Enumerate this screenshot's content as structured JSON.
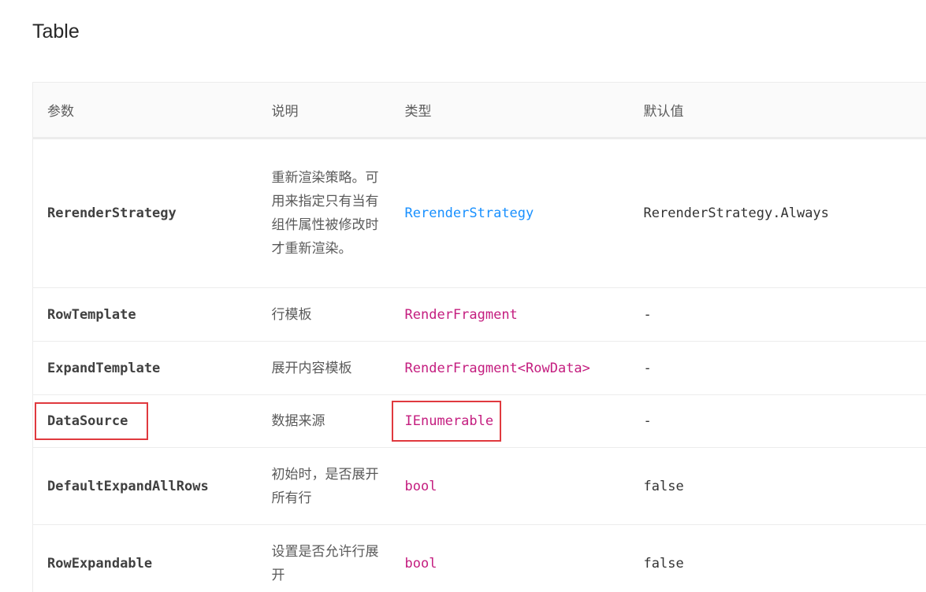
{
  "page": {
    "title": "Table"
  },
  "table": {
    "headers": [
      "参数",
      "说明",
      "类型",
      "默认值"
    ],
    "rows": [
      {
        "param": "RerenderStrategy",
        "description": "重新渲染策略。可用来指定只有当有组件属性被修改时才重新渲染。",
        "type": "RerenderStrategy",
        "type_style": "link",
        "default": "RerenderStrategy.Always"
      },
      {
        "param": "RowTemplate",
        "description": "行模板",
        "type": "RenderFragment",
        "type_style": "code",
        "default": "-"
      },
      {
        "param": "ExpandTemplate",
        "description": "展开内容模板",
        "type": "RenderFragment<RowData>",
        "type_style": "code",
        "default": "-"
      },
      {
        "param": "DataSource",
        "description": "数据来源",
        "type": "IEnumerable",
        "type_style": "code",
        "default": "-",
        "highlighted": true
      },
      {
        "param": "DefaultExpandAllRows",
        "description": "初始时，是否展开所有行",
        "type": "bool",
        "type_style": "code",
        "default": "false"
      },
      {
        "param": "RowExpandable",
        "description": "设置是否允许行展开",
        "type": "bool",
        "type_style": "code",
        "default": "false"
      }
    ]
  },
  "colors": {
    "link": "#1890ff",
    "code": "#c41d7f",
    "highlight_box": "#e0393e",
    "header_bg": "#fafafa",
    "border": "#ececec"
  }
}
